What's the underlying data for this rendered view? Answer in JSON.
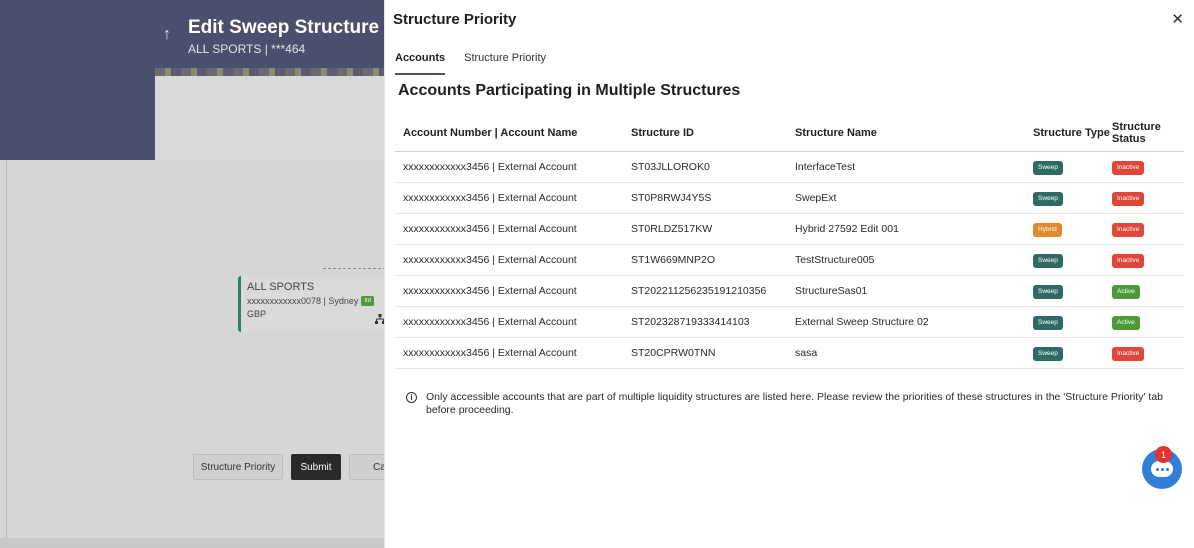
{
  "background": {
    "title": "Edit Sweep Structure",
    "subtitle": "ALL SPORTS | ***464",
    "node": {
      "name": "ALL SPORTS",
      "account": "xxxxxxxxxxxx0078 | Sydney",
      "badge": "Int",
      "currency": "GBP"
    },
    "buttons": {
      "priority": "Structure Priority",
      "submit": "Submit",
      "cancel": "Cancel"
    }
  },
  "modal": {
    "title": "Structure Priority",
    "close_icon": "close-icon",
    "tabs": [
      {
        "label": "Accounts",
        "active": true
      },
      {
        "label": "Structure Priority",
        "active": false
      }
    ],
    "section_title": "Accounts Participating in Multiple Structures",
    "table": {
      "headers": [
        "Account Number | Account Name",
        "Structure ID",
        "Structure Name",
        "Structure Type",
        "Structure Status"
      ],
      "rows": [
        {
          "account": "xxxxxxxxxxxx3456 | External Account",
          "id": "ST03JLLOROK0",
          "name": "InterfaceTest",
          "type": "Sweep",
          "status": "Inactive"
        },
        {
          "account": "xxxxxxxxxxxx3456 | External Account",
          "id": "ST0P8RWJ4Y5S",
          "name": "SwepExt",
          "type": "Sweep",
          "status": "Inactive"
        },
        {
          "account": "xxxxxxxxxxxx3456 | External Account",
          "id": "ST0RLDZ517KW",
          "name": "Hybrid 27592 Edit 001",
          "type": "Hybrid",
          "status": "Inactive"
        },
        {
          "account": "xxxxxxxxxxxx3456 | External Account",
          "id": "ST1W669MNP2O",
          "name": "TestStructure005",
          "type": "Sweep",
          "status": "Inactive"
        },
        {
          "account": "xxxxxxxxxxxx3456 | External Account",
          "id": "ST20221125623519121035​6",
          "name": "StructureSas01",
          "type": "Sweep",
          "status": "Active"
        },
        {
          "account": "xxxxxxxxxxxx3456 | External Account",
          "id": "ST202328719333414103",
          "name": "External Sweep Structure 02",
          "type": "Sweep",
          "status": "Active"
        },
        {
          "account": "xxxxxxxxxxxx3456 | External Account",
          "id": "ST20CPRW0TNN",
          "name": "sasa",
          "type": "Sweep",
          "status": "Inactive"
        }
      ]
    },
    "note": "Only accessible accounts that are part of multiple liquidity structures are listed here. Please review the priorities of these structures in the 'Structure Priority' tab before proceeding.",
    "chat": {
      "icon": "chat-icon",
      "count": "1"
    }
  },
  "colors": {
    "header": "#4a4f6d",
    "sweep": "#2f6b63",
    "hybrid": "#e08a2c",
    "inactive": "#e0463a",
    "active": "#4c9a3a"
  }
}
